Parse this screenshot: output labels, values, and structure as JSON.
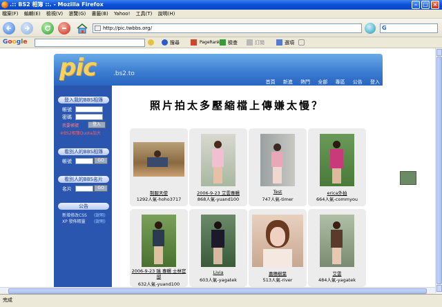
{
  "window": {
    "title": ".:: BS2 相簿 ::. - Mozilla Firefox"
  },
  "menu": [
    "檔案(F)",
    "編輯(E)",
    "檢視(V)",
    "瀏覽(G)",
    "書籤(B)",
    "Yahoo!",
    "工具(T)",
    "說明(H)"
  ],
  "nav": {
    "url": "http://pic.twbbs.org/"
  },
  "google_toolbar": {
    "logo": "Google",
    "search_label": "搜尋",
    "pagerank": "PageRank",
    "check": "檢查",
    "subscribe": "訂閱",
    "options": "選項"
  },
  "site": {
    "logo": "pic",
    "logo_sub": ".bs2.to",
    "topnav": [
      "首頁",
      "新進",
      "熱門",
      "全部",
      "專區",
      "公告",
      "登入"
    ],
    "banner": "照片拍太多壓縮檔上傳嫌太慢？",
    "sidebar": {
      "login_title": "登入我的BBS相簿",
      "account_label": "帳號",
      "password_label": "密碼",
      "forgot": "我要帳號",
      "login_btn": "登入",
      "quota": "※BS2相簿Quota加大",
      "view_title": "看別人的BBS相簿",
      "view_label": "帳號",
      "go1": "GO",
      "card_title": "看別人的BBS名片",
      "card_label": "名片",
      "go2": "GO",
      "notice_title": "公告",
      "notice1_text": "新增修改CSS",
      "notice1_link": "(說明)",
      "notice2_text": "XP 發佈精靈",
      "notice2_link": "(說明)"
    },
    "cards": [
      {
        "title": "制服天使",
        "meta": "1292人氣-hoho3717"
      },
      {
        "title": "2006-9-23 艾雲專輯",
        "meta": "868人氣-yuand100"
      },
      {
        "title": "Test",
        "meta": "747人氣-timer"
      },
      {
        "title": "erica外拍",
        "meta": "664人氣-commyou"
      },
      {
        "title": "2006-9-23 瑞 專輯 士林官邸",
        "meta": "632人氣-yuand100"
      },
      {
        "title": "Livia",
        "meta": "603人氣-yagatek"
      },
      {
        "title": "嘉穗樹葉",
        "meta": "513人氣-river"
      },
      {
        "title": "艾雲",
        "meta": "484人氣-yagatek"
      }
    ]
  },
  "status": "完成"
}
